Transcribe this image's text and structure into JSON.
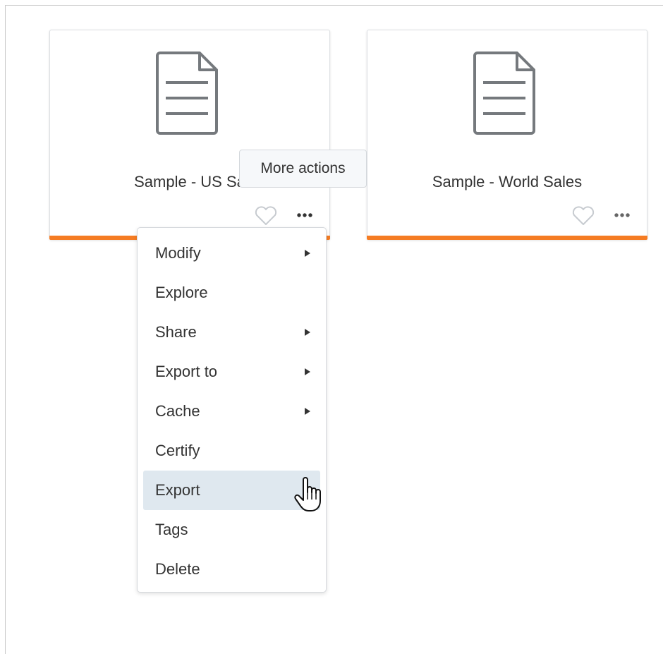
{
  "cards": [
    {
      "title": "Sample - US Sa",
      "favorite_icon": "heart-outline-icon",
      "more_icon": "more-horizontal-icon",
      "accent": "#f57c23"
    },
    {
      "title": "Sample - World Sales",
      "favorite_icon": "heart-outline-icon",
      "more_icon": "more-horizontal-icon",
      "accent": "#f57c23"
    }
  ],
  "tooltip": {
    "text": "More actions"
  },
  "menu": {
    "items": [
      {
        "label": "Modify",
        "has_submenu": true
      },
      {
        "label": "Explore",
        "has_submenu": false
      },
      {
        "label": "Share",
        "has_submenu": true
      },
      {
        "label": "Export to",
        "has_submenu": true
      },
      {
        "label": "Cache",
        "has_submenu": true
      },
      {
        "label": "Certify",
        "has_submenu": false
      },
      {
        "label": "Export",
        "has_submenu": false,
        "hovered": true
      },
      {
        "label": "Tags",
        "has_submenu": false
      },
      {
        "label": "Delete",
        "has_submenu": false
      }
    ]
  },
  "colors": {
    "accent": "#f57c23",
    "hover": "#dfe8ef"
  }
}
